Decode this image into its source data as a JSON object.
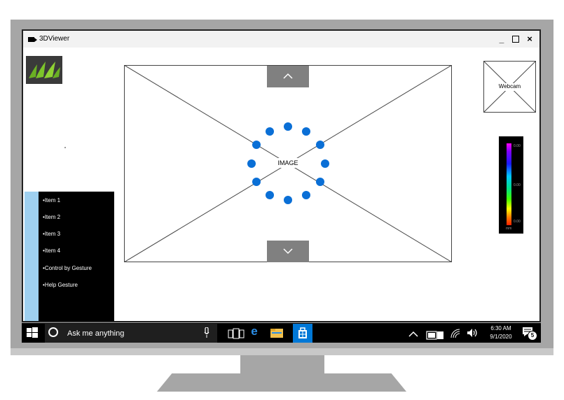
{
  "window": {
    "title": "3DViewer",
    "minimize_glyph": "_",
    "close_glyph": "×"
  },
  "viewer": {
    "image_label": "IMAGE",
    "up_glyph": "︿",
    "down_glyph": "﹀"
  },
  "menu": {
    "items": [
      {
        "label": "Item 1"
      },
      {
        "label": "Item 2"
      },
      {
        "label": "Item 3"
      },
      {
        "label": "Item 4"
      },
      {
        "label": "Control by Gesture"
      },
      {
        "label": "Help Gesture"
      }
    ]
  },
  "webcam": {
    "label": "Webcam"
  },
  "color_scale": {
    "top_value": "0.00",
    "mid_value": "0.00",
    "bottom_value": "0.00",
    "unit": "mm"
  },
  "taskbar": {
    "search_placeholder": "Ask me anything",
    "time": "6:30 AM",
    "date": "9/1/2020",
    "notification_count": "5",
    "edge_glyph": "e",
    "start_color": "#ffffff",
    "store_color": "#0078d7"
  },
  "colors": {
    "spinner_dot": "#0a6fd6",
    "menu_bg": "#000000",
    "side_strip": "#9fd0f0",
    "nav_button": "#808080"
  }
}
